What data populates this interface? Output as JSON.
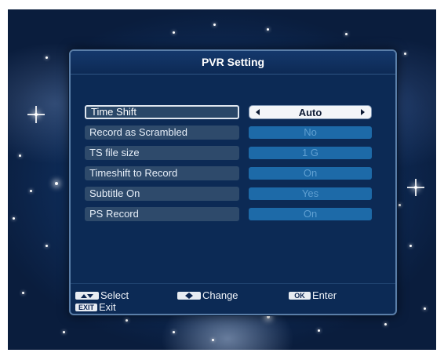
{
  "dialog": {
    "title": "PVR Setting"
  },
  "settings": [
    {
      "label": "Time Shift",
      "value": "Auto",
      "focused": true
    },
    {
      "label": "Record as Scrambled",
      "value": "No",
      "focused": false
    },
    {
      "label": "TS file size",
      "value": "1 G",
      "focused": false
    },
    {
      "label": "Timeshift to Record",
      "value": "On",
      "focused": false
    },
    {
      "label": "Subtitle On",
      "value": "Yes",
      "focused": false
    },
    {
      "label": "PS Record",
      "value": "On",
      "focused": false
    }
  ],
  "footer": {
    "select": {
      "key_icon": "up-down-arrows-icon",
      "label": "Select"
    },
    "change": {
      "key_icon": "left-right-arrows-icon",
      "label": "Change"
    },
    "enter": {
      "key": "OK",
      "label": "Enter"
    },
    "exit": {
      "key": "EXIT",
      "label": "Exit"
    }
  },
  "colors": {
    "dialog_bg": "#0c2a55",
    "label_bg": "#2e4a6b",
    "value_bg": "#1d6aa8",
    "value_text": "#5f9fd1",
    "focus_bg": "#f3f5f8"
  }
}
